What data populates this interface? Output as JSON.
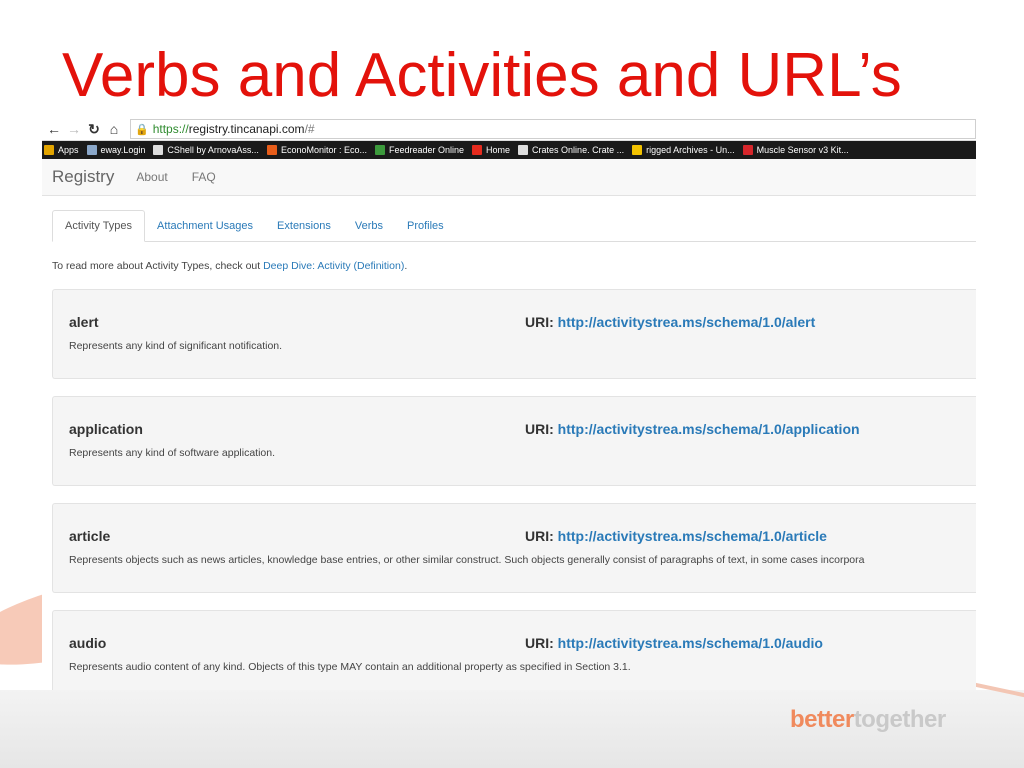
{
  "slide": {
    "title": "Verbs and Activities and URL’s",
    "brand_part1": "better",
    "brand_part2": "together",
    "accent_color": "#e3120b"
  },
  "browser": {
    "url_scheme": "https://",
    "url_host": "registry.tincanapi.com",
    "url_rest": "/#",
    "bookmarks": [
      "Apps",
      "eway.Login",
      "CShell by ArnovaAss...",
      "EconoMonitor : Eco...",
      "Feedreader Online",
      "Home",
      "Crates Online. Crate ...",
      "rigged Archives - Un...",
      "Muscle Sensor v3 Kit..."
    ]
  },
  "registry": {
    "brand": "Registry",
    "nav": [
      "About",
      "FAQ"
    ],
    "tabs": [
      "Activity Types",
      "Attachment Usages",
      "Extensions",
      "Verbs",
      "Profiles"
    ],
    "active_tab": "Activity Types",
    "intro_text": "To read more about Activity Types, check out ",
    "intro_link": "Deep Dive: Activity (Definition)",
    "intro_end": ".",
    "uri_label": "URI:",
    "activities": [
      {
        "name": "alert",
        "uri": "http://activitystrea.ms/schema/1.0/alert",
        "desc": "Represents any kind of significant notification."
      },
      {
        "name": "application",
        "uri": "http://activitystrea.ms/schema/1.0/application",
        "desc": "Represents any kind of software application."
      },
      {
        "name": "article",
        "uri": "http://activitystrea.ms/schema/1.0/article",
        "desc": "Represents objects such as news articles, knowledge base entries, or other similar construct. Such objects generally consist of paragraphs of text, in some cases incorpora"
      },
      {
        "name": "audio",
        "uri": "http://activitystrea.ms/schema/1.0/audio",
        "desc": "Represents audio content of any kind. Objects of this type MAY contain an additional property as specified in Section 3.1."
      }
    ]
  }
}
